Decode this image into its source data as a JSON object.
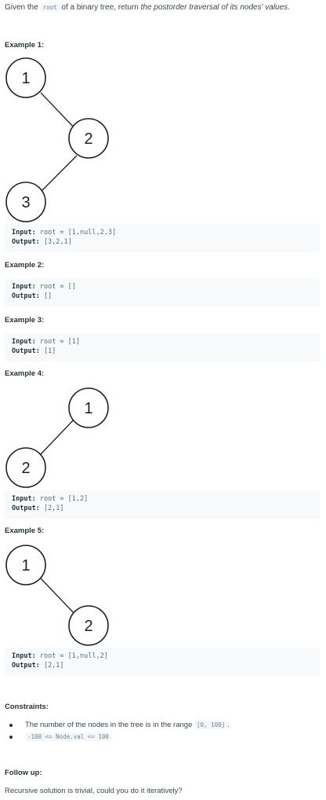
{
  "intro": {
    "prefix": "Given the ",
    "code": "root",
    "middle": " of a binary tree, return ",
    "emphasis": "the postorder traversal of its nodes' values",
    "suffix": "."
  },
  "examples": [
    {
      "heading": "Example 1:",
      "tree": {
        "nodes": [
          "1",
          "2",
          "3"
        ],
        "edges": [
          [
            "1",
            "2"
          ],
          [
            "2",
            "3"
          ]
        ]
      },
      "input_label": "Input:",
      "input_value": " root = [1,null,2,3]",
      "output_label": "Output:",
      "output_value": " [3,2,1]"
    },
    {
      "heading": "Example 2:",
      "input_label": "Input:",
      "input_value": " root = []",
      "output_label": "Output:",
      "output_value": " []"
    },
    {
      "heading": "Example 3:",
      "input_label": "Input:",
      "input_value": " root = [1]",
      "output_label": "Output:",
      "output_value": " [1]"
    },
    {
      "heading": "Example 4:",
      "tree": {
        "nodes": [
          "1",
          "2"
        ],
        "edges": [
          [
            "1",
            "2"
          ]
        ]
      },
      "input_label": "Input:",
      "input_value": " root = [1,2]",
      "output_label": "Output:",
      "output_value": " [2,1]"
    },
    {
      "heading": "Example 5:",
      "tree": {
        "nodes": [
          "1",
          "2"
        ],
        "edges": [
          [
            "1",
            "2"
          ]
        ]
      },
      "input_label": "Input:",
      "input_value": " root = [1,null,2]",
      "output_label": "Output:",
      "output_value": " [2,1]"
    }
  ],
  "constraints": {
    "heading": "Constraints:",
    "item1_text": "The number of the nodes in the tree is in the range ",
    "item1_code": "[0, 100]",
    "item1_suffix": ".",
    "item2_code": "-100 <= Node.val <= 100"
  },
  "follow_up": {
    "heading": "Follow up:",
    "text": "Recursive solution is trivial, could you do it iteratively?"
  }
}
